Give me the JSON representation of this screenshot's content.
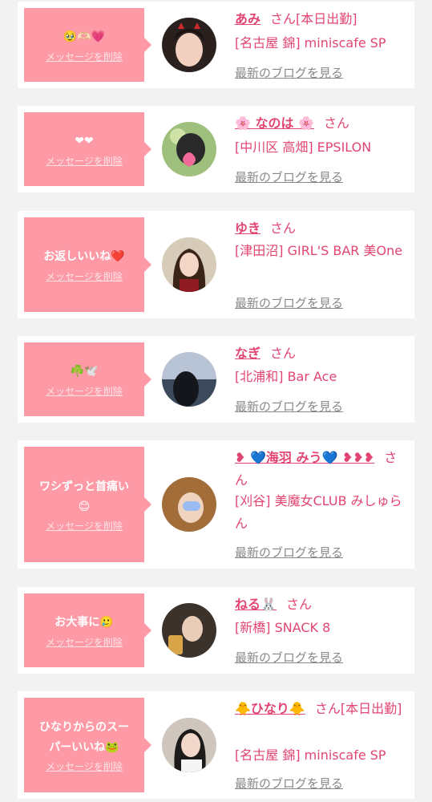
{
  "delete_label": "メッセージを削除",
  "blog_label": "最新のブログを見る",
  "honorific": "さん",
  "colors": {
    "bubble": "#fd9aa6",
    "accent": "#e24572",
    "link_gray": "#888888",
    "page_bg": "#f2f2f2"
  },
  "cards": [
    {
      "message": "🥹🫶🏻💗",
      "name": "あみ",
      "status": "[本日出勤]",
      "shop": "[名古屋 錦] miniscafe SP"
    },
    {
      "message": "❤︎❤︎",
      "name": "🌸 なのは 🌸",
      "status": "",
      "shop": "[中川区 高畑] EPSILON"
    },
    {
      "message": "お返しいいね❤️",
      "name": "ゆき",
      "status": "",
      "shop": "[津田沼] GIRL'S BAR 美One"
    },
    {
      "message": "☘️🕊️",
      "name": "なぎ",
      "status": "",
      "shop": "[北浦和] Bar Ace"
    },
    {
      "message": "ワシずっと首痛い😊",
      "name": "❥ 💙海羽 みう💙 ❥❥❥",
      "status": "",
      "shop": "[刈谷] 美魔女CLUB みしゅらん"
    },
    {
      "message": "お大事に🥲",
      "name": "ねる🐰",
      "status": "",
      "shop": "[新橋] SNACK 8"
    },
    {
      "message": "ひなりからのスーパーいいね🐸",
      "name": "🐥ひなり🐥",
      "status": "[本日出勤]",
      "shop": "[名古屋 錦] miniscafe SP"
    }
  ]
}
